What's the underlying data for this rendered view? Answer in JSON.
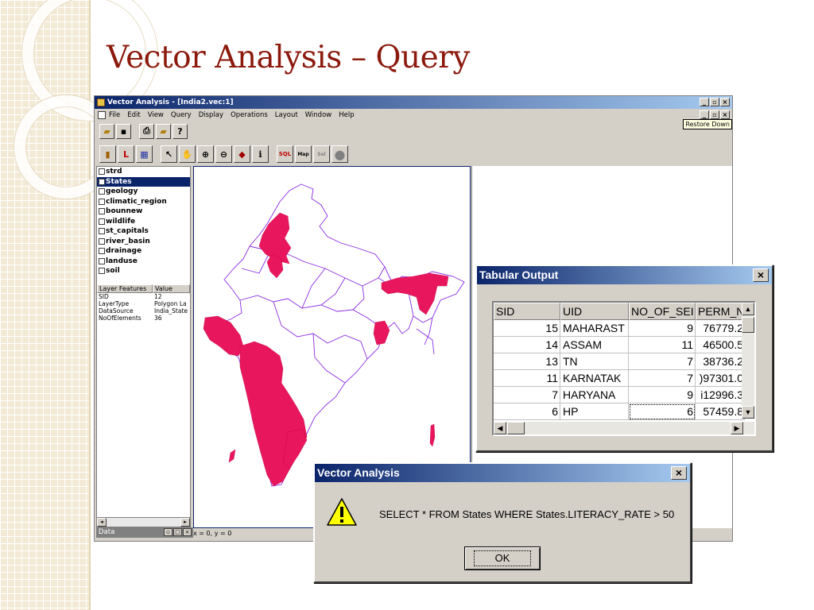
{
  "slide": {
    "title": "Vector Analysis – Query"
  },
  "app": {
    "title": "Vector Analysis - [India2.vec:1]",
    "menu": [
      "File",
      "Edit",
      "View",
      "Query",
      "Display",
      "Operations",
      "Layout",
      "Window",
      "Help"
    ],
    "tooltip": "Restore Down",
    "layers": [
      {
        "name": "strd",
        "checked": false
      },
      {
        "name": "States",
        "checked": true
      },
      {
        "name": "geology",
        "checked": false
      },
      {
        "name": "climatic_region",
        "checked": false
      },
      {
        "name": "bounnew",
        "checked": false
      },
      {
        "name": "wildlife",
        "checked": false
      },
      {
        "name": "st_capitals",
        "checked": false
      },
      {
        "name": "river_basin",
        "checked": false
      },
      {
        "name": "drainage",
        "checked": false
      },
      {
        "name": "landuse",
        "checked": false
      },
      {
        "name": "soil",
        "checked": false
      }
    ],
    "props_header": {
      "col1": "Layer Features",
      "col2": "Value"
    },
    "props": [
      {
        "k": "SID",
        "v": "12"
      },
      {
        "k": "LayerType",
        "v": "Polygon La"
      },
      {
        "k": "DataSource",
        "v": "India_State"
      },
      {
        "k": "NoOfElements",
        "v": "36"
      }
    ],
    "data_tab": "Data",
    "status": "x = 0,  y = 0",
    "highlight_color": "#e8175d",
    "outline_color": "#8a2be2"
  },
  "tabular": {
    "title": "Tabular Output",
    "headers": [
      "SID",
      "UID",
      "NO_OF_SEI",
      "PERM_N"
    ],
    "rows": [
      {
        "sid": "15",
        "uid": "MAHARAST",
        "seats": "9",
        "perm": "76779.2"
      },
      {
        "sid": "14",
        "uid": "ASSAM",
        "seats": "11",
        "perm": "46500.5"
      },
      {
        "sid": "13",
        "uid": "TN",
        "seats": "7",
        "perm": "38736.2"
      },
      {
        "sid": "11",
        "uid": "KARNATAK",
        "seats": "7",
        "perm": ")97301.0"
      },
      {
        "sid": "7",
        "uid": "HARYANA",
        "seats": "9",
        "perm": "i12996.3"
      },
      {
        "sid": "6",
        "uid": "HP",
        "seats": "6",
        "perm": "57459.8"
      }
    ]
  },
  "query_dialog": {
    "title": "Vector Analysis",
    "message": "SELECT * FROM States WHERE States.LITERACY_RATE > 50",
    "ok": "OK",
    "icon": "warning-icon"
  }
}
